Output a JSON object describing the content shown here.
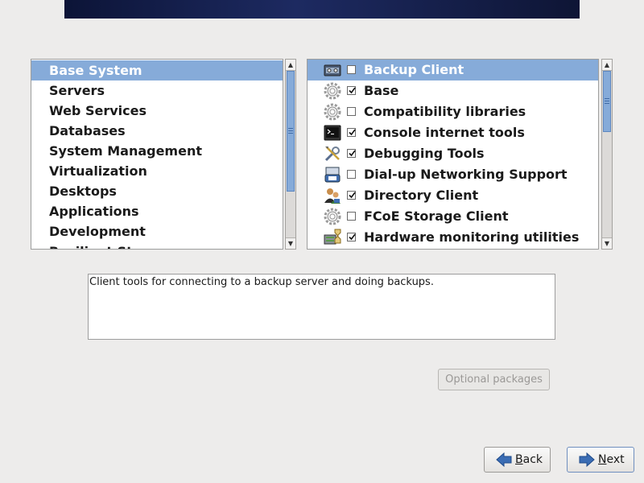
{
  "categories": {
    "items": [
      {
        "label": "Base System",
        "selected": true
      },
      {
        "label": "Servers"
      },
      {
        "label": "Web Services"
      },
      {
        "label": "Databases"
      },
      {
        "label": "System Management"
      },
      {
        "label": "Virtualization"
      },
      {
        "label": "Desktops"
      },
      {
        "label": "Applications"
      },
      {
        "label": "Development"
      },
      {
        "label": "Resilient Storage"
      }
    ]
  },
  "packages": {
    "items": [
      {
        "label": "Backup Client",
        "checked": false,
        "icon": "backup-icon",
        "selected": true
      },
      {
        "label": "Base",
        "checked": true,
        "icon": "gear-icon"
      },
      {
        "label": "Compatibility libraries",
        "checked": false,
        "icon": "gear-icon"
      },
      {
        "label": "Console internet tools",
        "checked": true,
        "icon": "terminal-icon"
      },
      {
        "label": "Debugging Tools",
        "checked": true,
        "icon": "tools-icon"
      },
      {
        "label": "Dial-up Networking Support",
        "checked": false,
        "icon": "phone-icon"
      },
      {
        "label": "Directory Client",
        "checked": true,
        "icon": "users-icon"
      },
      {
        "label": "FCoE Storage Client",
        "checked": false,
        "icon": "gear-icon"
      },
      {
        "label": "Hardware monitoring utilities",
        "checked": true,
        "icon": "hardware-monitor-icon"
      }
    ]
  },
  "description": {
    "text": "Client tools for connecting to a backup server and doing backups."
  },
  "buttons": {
    "optional_packages": "Optional packages",
    "back_mnemonic": "B",
    "back_rest": "ack",
    "next_mnemonic": "N",
    "next_rest": "ext"
  },
  "colors": {
    "selection": "#86abd9",
    "banner": "#1d2a61",
    "background": "#edeceb"
  }
}
